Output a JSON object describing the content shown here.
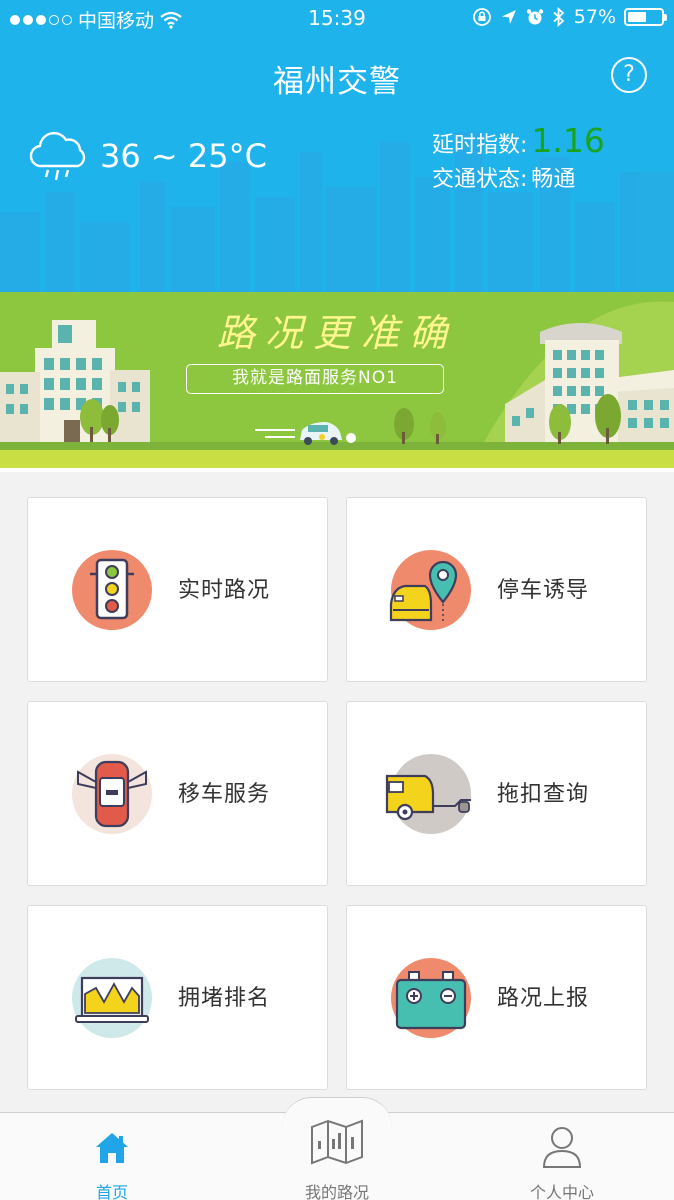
{
  "status_bar": {
    "carrier": "中国移动",
    "time": "15:39",
    "battery": "57%",
    "battery_level": 0.57,
    "signal_bars_filled": 3,
    "signal_bars_total": 5
  },
  "header": {
    "title": "福州交警",
    "help_icon": "question-circle-icon",
    "help_label": "?",
    "weather": {
      "icon": "cloud-rain-icon",
      "temperature": "36 ~ 25°C"
    },
    "delay_index_label": "延时指数:",
    "delay_index_value": "1.16",
    "traffic_status_label": "交通状态:",
    "traffic_status_value": "畅通"
  },
  "banner": {
    "title": "路况更准确",
    "subtitle": "我就是路面服务NO1"
  },
  "services": [
    {
      "label": "实时路况",
      "icon": "traffic-light-icon"
    },
    {
      "label": "停车诱导",
      "icon": "parking-location-icon"
    },
    {
      "label": "移车服务",
      "icon": "car-move-icon"
    },
    {
      "label": "拖扣查询",
      "icon": "tow-truck-icon"
    },
    {
      "label": "拥堵排名",
      "icon": "congestion-chart-icon"
    },
    {
      "label": "路况上报",
      "icon": "battery-report-icon"
    }
  ],
  "tabbar": {
    "tabs": [
      {
        "label": "首页",
        "icon": "home-icon",
        "active": true
      },
      {
        "label": "我的路况",
        "icon": "map-icon",
        "active": false
      },
      {
        "label": "个人中心",
        "icon": "user-icon",
        "active": false
      }
    ]
  },
  "colors": {
    "header_blue": "#1fb3ec",
    "delay_green": "#1aa321",
    "banner_green": "#8dc63f",
    "active_tab": "#1fa5e8"
  }
}
